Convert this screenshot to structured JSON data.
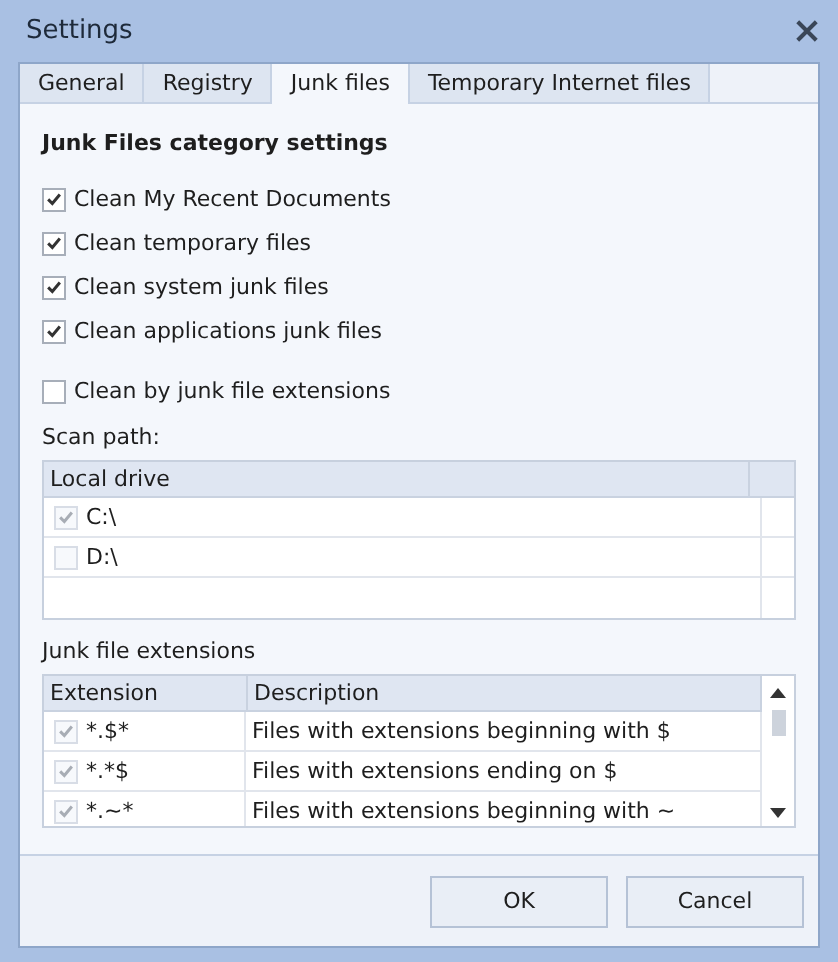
{
  "window": {
    "title": "Settings"
  },
  "tabs": [
    {
      "label": "General",
      "selected": false
    },
    {
      "label": "Registry",
      "selected": false
    },
    {
      "label": "Junk files",
      "selected": true
    },
    {
      "label": "Temporary Internet files",
      "selected": false
    }
  ],
  "heading": "Junk Files category settings",
  "options": [
    {
      "label": "Clean My Recent Documents",
      "checked": true
    },
    {
      "label": "Clean temporary files",
      "checked": true
    },
    {
      "label": "Clean system junk files",
      "checked": true
    },
    {
      "label": "Clean applications junk files",
      "checked": true
    }
  ],
  "extension_option": {
    "label": "Clean by junk file extensions",
    "checked": false
  },
  "scan_path": {
    "label": "Scan path:",
    "columns": [
      "Local drive"
    ],
    "rows": [
      {
        "drive": "C:\\",
        "checked": true,
        "disabled": true
      },
      {
        "drive": "D:\\",
        "checked": false,
        "disabled": true
      }
    ]
  },
  "extensions": {
    "label": "Junk file extensions",
    "columns": [
      "Extension",
      "Description"
    ],
    "rows": [
      {
        "extension": "*.$*",
        "description": "Files with extensions beginning with $",
        "checked": true,
        "disabled": true
      },
      {
        "extension": "*.*$",
        "description": "Files with extensions ending on $",
        "checked": true,
        "disabled": true
      },
      {
        "extension": "*.~*",
        "description": "Files with extensions beginning with ~",
        "checked": true,
        "disabled": true
      }
    ]
  },
  "buttons": [
    "OK",
    "Cancel"
  ]
}
